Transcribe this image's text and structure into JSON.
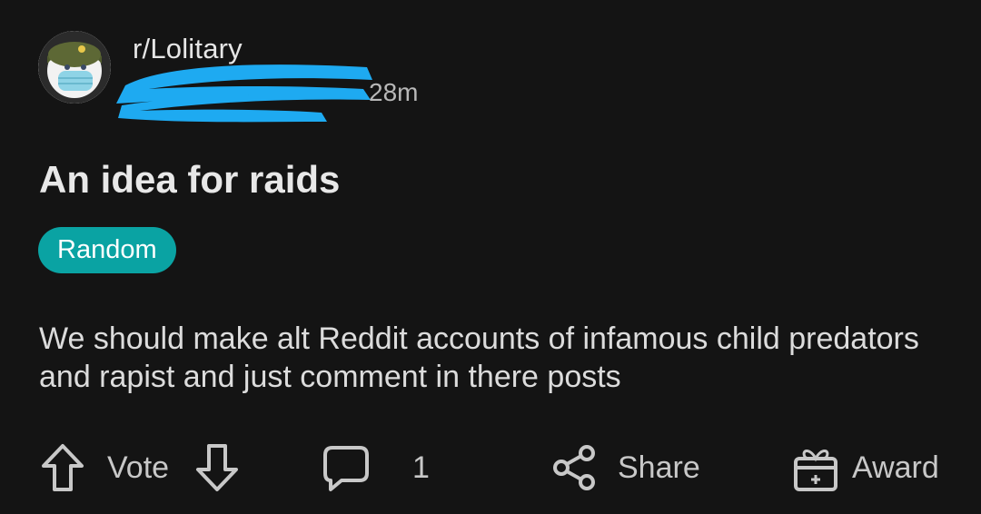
{
  "post": {
    "subreddit": "r/Lolitary",
    "age": "28m",
    "title": "An idea for raids",
    "flair": "Random",
    "body": "We should make alt Reddit accounts of infamous child predators and rapist and just comment in there posts"
  },
  "actions": {
    "vote_label": "Vote",
    "comment_count": "1",
    "share_label": "Share",
    "award_label": "Award"
  },
  "colors": {
    "background": "#141414",
    "flair_bg": "#0aa3a3",
    "redaction": "#1eaaf1",
    "text": "#e6e6e6",
    "muted": "#b8b8b8"
  },
  "icons": {
    "avatar": "subreddit-avatar",
    "upvote": "arrow-up-icon",
    "downvote": "arrow-down-icon",
    "comment": "comment-bubble-icon",
    "share": "share-icon",
    "award": "gift-icon"
  }
}
